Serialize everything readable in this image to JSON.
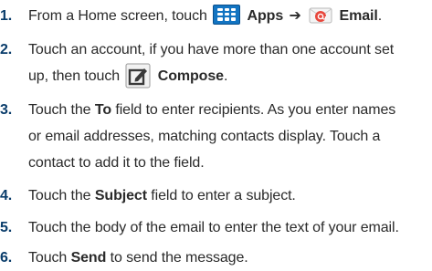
{
  "steps": [
    {
      "number": "1.",
      "t1": "From a Home screen, touch",
      "b1": "Apps",
      "arrow": "➔",
      "b2": "Email",
      "end": "."
    },
    {
      "number": "2.",
      "line1": "Touch an account, if you have more than one account set",
      "t2": "up, then touch",
      "b1": "Compose",
      "end": "."
    },
    {
      "number": "3.",
      "t1": "Touch the",
      "b1": "To",
      "t1b": "field to enter recipients. As you enter names",
      "line2": "or email addresses, matching contacts display. Touch a",
      "line3": "contact to add it to the field."
    },
    {
      "number": "4.",
      "t1": "Touch the",
      "b1": "Subject",
      "t2": "field to enter a subject."
    },
    {
      "number": "5.",
      "text": "Touch the body of the email to enter the text of your email."
    },
    {
      "number": "6.",
      "t1": "Touch",
      "b1": "Send",
      "t2": "to send the message."
    }
  ],
  "icons": {
    "apps": "apps-grid-icon",
    "email": "email-envelope-icon",
    "compose": "compose-icon"
  },
  "colors": {
    "step_number": "#0a3d6b",
    "apps_icon": "#1274c2",
    "email_icon": "#e8473c"
  }
}
